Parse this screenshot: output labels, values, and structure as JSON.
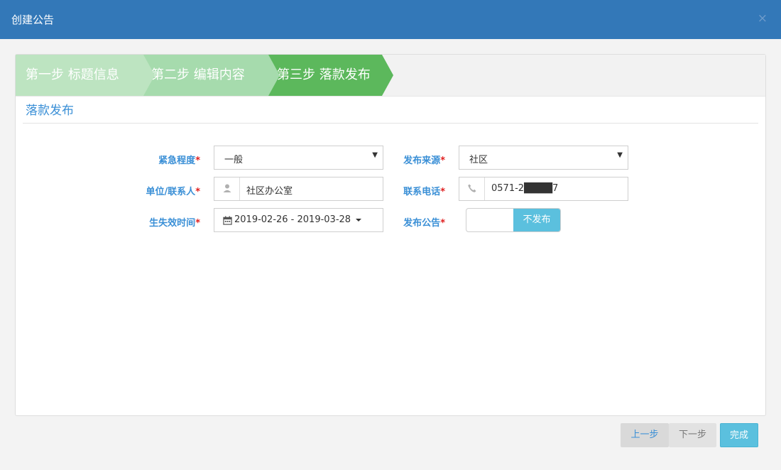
{
  "dialog": {
    "title": "创建公告",
    "close": "×"
  },
  "steps": [
    {
      "label": "第一步 标题信息"
    },
    {
      "label": "第二步 编辑内容"
    },
    {
      "label": "第三步 落款发布"
    }
  ],
  "section": {
    "title": "落款发布"
  },
  "form": {
    "urgency": {
      "label": "紧急程度",
      "value": "一般"
    },
    "source": {
      "label": "发布来源",
      "value": "社区"
    },
    "contact": {
      "label": "单位/联系人",
      "value": "社区办公室",
      "icon": "user-icon"
    },
    "phone": {
      "label": "联系电话",
      "value": "0571-2████7",
      "icon": "phone-icon"
    },
    "validity": {
      "label": "生失效时间",
      "value": "2019-02-26 - 2019-03-28",
      "icon": "calendar-icon"
    },
    "publish": {
      "label": "发布公告",
      "value": "不发布"
    },
    "required_mark": "*"
  },
  "buttons": {
    "prev": "上一步",
    "next": "下一步",
    "done": "完成"
  },
  "colors": {
    "header": "#3378b8",
    "accent": "#3a8fd6",
    "step_active": "#5cb85c",
    "info": "#5bc0de"
  }
}
